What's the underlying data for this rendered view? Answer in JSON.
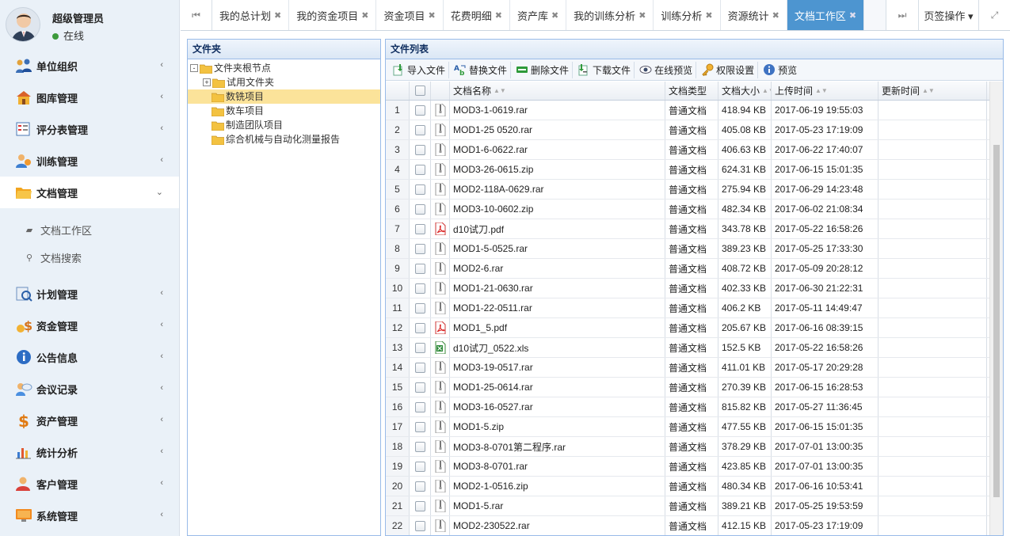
{
  "user": {
    "name": "超级管理员",
    "status": "在线",
    "status_color": "#3c9a3c"
  },
  "menu": [
    {
      "label": "单位组织",
      "icon": "org-icon",
      "arrow": "‹"
    },
    {
      "label": "图库管理",
      "icon": "gallery-icon",
      "arrow": "‹"
    },
    {
      "label": "评分表管理",
      "icon": "scoresheet-icon",
      "arrow": "‹"
    },
    {
      "label": "训练管理",
      "icon": "training-icon",
      "arrow": "‹"
    },
    {
      "label": "文档管理",
      "icon": "folder-icon",
      "arrow": "⌄"
    },
    {
      "label": "计划管理",
      "icon": "plan-icon",
      "arrow": "‹"
    },
    {
      "label": "资金管理",
      "icon": "money-icon",
      "arrow": "‹"
    },
    {
      "label": "公告信息",
      "icon": "info-icon",
      "arrow": "‹"
    },
    {
      "label": "会议记录",
      "icon": "meeting-icon",
      "arrow": "‹"
    },
    {
      "label": "资产管理",
      "icon": "asset-icon",
      "arrow": "‹"
    },
    {
      "label": "统计分析",
      "icon": "stats-icon",
      "arrow": "‹"
    },
    {
      "label": "客户管理",
      "icon": "customer-icon",
      "arrow": "‹"
    },
    {
      "label": "系统管理",
      "icon": "system-icon",
      "arrow": "‹"
    }
  ],
  "submenu": [
    {
      "label": "文档工作区",
      "icon": "book-icon"
    },
    {
      "label": "文档搜索",
      "icon": "search-icon"
    }
  ],
  "tabs": [
    {
      "label": "我的总计划"
    },
    {
      "label": "我的资金项目"
    },
    {
      "label": "资金项目"
    },
    {
      "label": "花费明细"
    },
    {
      "label": "资产库"
    },
    {
      "label": "我的训练分析"
    },
    {
      "label": "训练分析"
    },
    {
      "label": "资源统计"
    },
    {
      "label": "文档工作区"
    }
  ],
  "tab_close": "✖",
  "tab_nav_left": "⏮",
  "tab_nav_right": "⏭",
  "tab_ops": "页签操作 ▾",
  "tab_fullscreen": "⤢",
  "folder_panel": {
    "title": "文件夹",
    "nodes": [
      {
        "label": "文件夹根节点",
        "toggle": "-",
        "level": 0
      },
      {
        "label": "试用文件夹",
        "toggle": "+",
        "level": 1
      },
      {
        "label": "数铣项目",
        "toggle": "",
        "level": 1,
        "selected": true
      },
      {
        "label": "数车项目",
        "toggle": "",
        "level": 1
      },
      {
        "label": "制造团队项目",
        "toggle": "",
        "level": 1
      },
      {
        "label": "综合机械与自动化测量报告",
        "toggle": "",
        "level": 1
      }
    ]
  },
  "file_panel": {
    "title": "文件列表",
    "toolbar": [
      {
        "label": "导入文件",
        "icon": "import-icon"
      },
      {
        "label": "替换文件",
        "icon": "replace-icon"
      },
      {
        "label": "删除文件",
        "icon": "delete-icon"
      },
      {
        "label": "下载文件",
        "icon": "download-icon"
      },
      {
        "label": "在线预览",
        "icon": "eye-icon"
      },
      {
        "label": "权限设置",
        "icon": "key-icon"
      },
      {
        "label": "预览",
        "icon": "info-icon"
      }
    ],
    "columns": {
      "name": "文档名称",
      "type": "文档类型",
      "size": "文档大小",
      "uploaded": "上传时间",
      "updated": "更新时间"
    },
    "rows": [
      {
        "n": "1",
        "icon": "archive",
        "name": "MOD3-1-0619.rar",
        "type": "普通文档",
        "size": "418.94 KB",
        "uploaded": "2017-06-19 19:55:03",
        "updated": ""
      },
      {
        "n": "2",
        "icon": "archive",
        "name": "MOD1-25 0520.rar",
        "type": "普通文档",
        "size": "405.08 KB",
        "uploaded": "2017-05-23 17:19:09",
        "updated": ""
      },
      {
        "n": "3",
        "icon": "archive",
        "name": "MOD1-6-0622.rar",
        "type": "普通文档",
        "size": "406.63 KB",
        "uploaded": "2017-06-22 17:40:07",
        "updated": ""
      },
      {
        "n": "4",
        "icon": "archive",
        "name": "MOD3-26-0615.zip",
        "type": "普通文档",
        "size": "624.31 KB",
        "uploaded": "2017-06-15 15:01:35",
        "updated": ""
      },
      {
        "n": "5",
        "icon": "archive",
        "name": "MOD2-118A-0629.rar",
        "type": "普通文档",
        "size": "275.94 KB",
        "uploaded": "2017-06-29 14:23:48",
        "updated": ""
      },
      {
        "n": "6",
        "icon": "archive",
        "name": "MOD3-10-0602.zip",
        "type": "普通文档",
        "size": "482.34 KB",
        "uploaded": "2017-06-02 21:08:34",
        "updated": ""
      },
      {
        "n": "7",
        "icon": "pdf",
        "name": "d10试刀.pdf",
        "type": "普通文档",
        "size": "343.78 KB",
        "uploaded": "2017-05-22 16:58:26",
        "updated": ""
      },
      {
        "n": "8",
        "icon": "archive",
        "name": "MOD1-5-0525.rar",
        "type": "普通文档",
        "size": "389.23 KB",
        "uploaded": "2017-05-25 17:33:30",
        "updated": ""
      },
      {
        "n": "9",
        "icon": "archive",
        "name": "MOD2-6.rar",
        "type": "普通文档",
        "size": "408.72 KB",
        "uploaded": "2017-05-09 20:28:12",
        "updated": ""
      },
      {
        "n": "10",
        "icon": "archive",
        "name": "MOD1-21-0630.rar",
        "type": "普通文档",
        "size": "402.33 KB",
        "uploaded": "2017-06-30 21:22:31",
        "updated": ""
      },
      {
        "n": "11",
        "icon": "archive",
        "name": "MOD1-22-0511.rar",
        "type": "普通文档",
        "size": "406.2 KB",
        "uploaded": "2017-05-11 14:49:47",
        "updated": ""
      },
      {
        "n": "12",
        "icon": "pdf",
        "name": "MOD1_5.pdf",
        "type": "普通文档",
        "size": "205.67 KB",
        "uploaded": "2017-06-16 08:39:15",
        "updated": ""
      },
      {
        "n": "13",
        "icon": "excel",
        "name": "d10试刀_0522.xls",
        "type": "普通文档",
        "size": "152.5 KB",
        "uploaded": "2017-05-22 16:58:26",
        "updated": ""
      },
      {
        "n": "14",
        "icon": "archive",
        "name": "MOD3-19-0517.rar",
        "type": "普通文档",
        "size": "411.01 KB",
        "uploaded": "2017-05-17 20:29:28",
        "updated": ""
      },
      {
        "n": "15",
        "icon": "archive",
        "name": "MOD1-25-0614.rar",
        "type": "普通文档",
        "size": "270.39 KB",
        "uploaded": "2017-06-15 16:28:53",
        "updated": ""
      },
      {
        "n": "16",
        "icon": "archive",
        "name": "MOD3-16-0527.rar",
        "type": "普通文档",
        "size": "815.82 KB",
        "uploaded": "2017-05-27 11:36:45",
        "updated": ""
      },
      {
        "n": "17",
        "icon": "archive",
        "name": "MOD1-5.zip",
        "type": "普通文档",
        "size": "477.55 KB",
        "uploaded": "2017-06-15 15:01:35",
        "updated": ""
      },
      {
        "n": "18",
        "icon": "archive",
        "name": "MOD3-8-0701第二程序.rar",
        "type": "普通文档",
        "size": "378.29 KB",
        "uploaded": "2017-07-01 13:00:35",
        "updated": ""
      },
      {
        "n": "19",
        "icon": "archive",
        "name": "MOD3-8-0701.rar",
        "type": "普通文档",
        "size": "423.85 KB",
        "uploaded": "2017-07-01 13:00:35",
        "updated": ""
      },
      {
        "n": "20",
        "icon": "archive",
        "name": "MOD2-1-0516.zip",
        "type": "普通文档",
        "size": "480.34 KB",
        "uploaded": "2017-06-16 10:53:41",
        "updated": ""
      },
      {
        "n": "21",
        "icon": "archive",
        "name": "MOD1-5.rar",
        "type": "普通文档",
        "size": "389.21 KB",
        "uploaded": "2017-05-25 19:53:59",
        "updated": ""
      },
      {
        "n": "22",
        "icon": "archive",
        "name": "MOD2-230522.rar",
        "type": "普通文档",
        "size": "412.15 KB",
        "uploaded": "2017-05-23 17:19:09",
        "updated": ""
      }
    ]
  },
  "colors": {
    "active_tab": "#4d95d0",
    "selected_node": "#fbe39a",
    "panel_border": "#99bbe8"
  }
}
